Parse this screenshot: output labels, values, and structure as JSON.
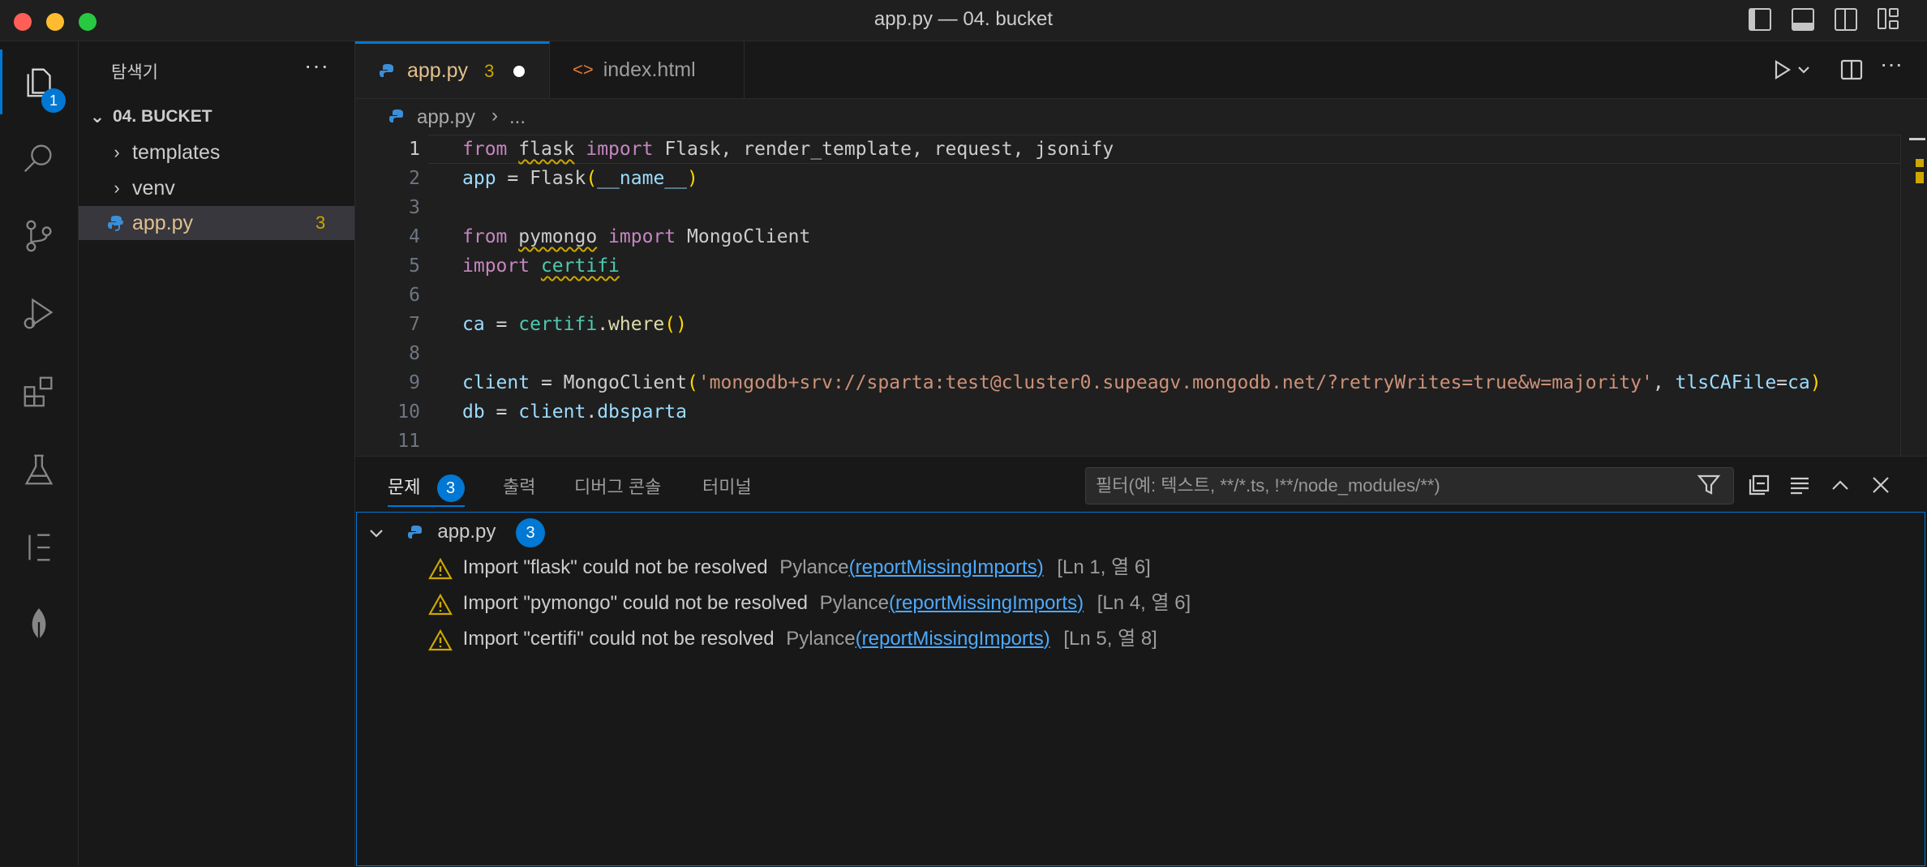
{
  "window": {
    "title": "app.py — 04. bucket"
  },
  "activity_bar": {
    "explorer_badge": "1"
  },
  "sidebar": {
    "title": "탐색기",
    "more": "···",
    "folder": "04. BUCKET",
    "items": [
      {
        "label": "templates"
      },
      {
        "label": "venv"
      },
      {
        "label": "app.py",
        "badge": "3"
      }
    ]
  },
  "tabs": [
    {
      "label": "app.py",
      "badge": "3"
    },
    {
      "label": "index.html"
    }
  ],
  "breadcrumb": {
    "file": "app.py",
    "sep": "›",
    "rest": "..."
  },
  "editor": {
    "lines": [
      "1",
      "2",
      "3",
      "4",
      "5",
      "6",
      "7",
      "8",
      "9",
      "10",
      "11"
    ],
    "code": {
      "l1": {
        "from": "from",
        "flask": "flask",
        "import": "import",
        "rest": "Flask, render_template, request, jsonify"
      },
      "l2": {
        "app": "app",
        "eq": " = ",
        "cls": "Flask",
        "open": "(",
        "arg": "__name__",
        "close": ")"
      },
      "l4": {
        "from": "from",
        "mod": "pymongo",
        "import": "import",
        "rest": "MongoClient"
      },
      "l5": {
        "import": "import",
        "mod": "certifi"
      },
      "l7": {
        "ca": "ca",
        "eq": " = ",
        "mod": "certifi",
        "dot": ".",
        "fn": "where",
        "parens": "()"
      },
      "l9": {
        "client": "client",
        "eq": " = ",
        "cls": "MongoClient",
        "open": "(",
        "str": "'mongodb+srv://sparta:test@cluster0.supeagv.mongodb.net/?retryWrites=true&w=majority'",
        "comma": ", ",
        "kw": "tlsCAFile",
        "assign": "=",
        "ca": "ca",
        "close": ")"
      },
      "l10": {
        "db": "db",
        "eq": " = ",
        "client": "client",
        "dot": ".",
        "attr": "dbsparta"
      }
    }
  },
  "panel": {
    "tabs": [
      {
        "label": "문제",
        "badge": "3"
      },
      {
        "label": "출력"
      },
      {
        "label": "디버그 콘솔"
      },
      {
        "label": "터미널"
      }
    ],
    "filter_placeholder": "필터(예: 텍스트, **/*.ts, !**/node_modules/**)",
    "group": {
      "file": "app.py",
      "count": "3"
    },
    "problems": [
      {
        "message": "Import \"flask\" could not be resolved",
        "source": "Pylance",
        "open": "(",
        "code": "reportMissingImports",
        "close": ")",
        "location": "[Ln 1, 열 6]"
      },
      {
        "message": "Import \"pymongo\" could not be resolved",
        "source": "Pylance",
        "open": "(",
        "code": "reportMissingImports",
        "close": ")",
        "location": "[Ln 4, 열 6]"
      },
      {
        "message": "Import \"certifi\" could not be resolved",
        "source": "Pylance",
        "open": "(",
        "code": "reportMissingImports",
        "close": ")",
        "location": "[Ln 5, 열 8]"
      }
    ]
  },
  "colors": {
    "accent": "#0078d4",
    "warning": "#cca700",
    "tab_active_text": "#e2c08d"
  }
}
